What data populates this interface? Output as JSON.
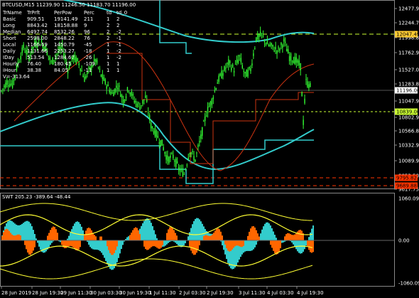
{
  "header": {
    "symbol_line": "BTCUSD,M15  11239.90 11246.50 11183.70 11196.00"
  },
  "stats_table": {
    "columns": [
      "TrName",
      "TrPrft",
      "PerPow",
      "Perc",
      "td",
      "td_0"
    ],
    "rows": [
      [
        "Basic",
        "909.51",
        "19141.49",
        "211",
        "1",
        "2"
      ],
      [
        "Long",
        "8843.42",
        "18158.88",
        "9",
        "2",
        "2"
      ],
      [
        "Median",
        "6497.74",
        "8532.26",
        "96",
        "2",
        "-2"
      ],
      [
        "Short",
        "2598.00",
        "2848.22",
        "76",
        "2",
        "-1"
      ],
      [
        "Local",
        "1166.69",
        "1450.79",
        "-45",
        "1",
        "-1"
      ],
      [
        "Daily",
        "1131.66",
        "2253.27",
        "-18",
        "1",
        "-2"
      ],
      [
        "IDay",
        "513.54",
        "1284.67",
        "-26",
        "1",
        "-2"
      ],
      [
        "Hourly",
        "76.40",
        "180.45",
        "-109",
        "1",
        "1"
      ],
      [
        "iHour",
        "38.38",
        "84.05",
        "-11",
        "1",
        "1"
      ]
    ],
    "footer": "V=-313.64"
  },
  "price_axis": {
    "ticks": [
      "12477.95",
      "12244.70",
      "11998.85",
      "11762.96",
      "11527.00",
      "11283.80",
      "11047.95",
      "10802.99",
      "10566.80",
      "10332.95",
      "10089.90",
      "9853.50",
      "9617.75"
    ],
    "markers": [
      {
        "text": "12047.49",
        "color": "#ffcc33",
        "text_color": "#000000"
      },
      {
        "text": "11196.00",
        "color": "#ffffff",
        "text_color": "#000000"
      },
      {
        "text": "10839.00",
        "color": "#ccff33",
        "text_color": "#000000"
      },
      {
        "text": "9795.82",
        "color": "#ff3300",
        "text_color": "#000000"
      },
      {
        "text": "9689.88",
        "color": "#ff3300",
        "text_color": "#000000"
      }
    ]
  },
  "oscillator": {
    "label": "SWT 205.23 -389.64 -48.44",
    "ticks": [
      "1060.09",
      "0.00",
      "-1060.09"
    ]
  },
  "time_axis": {
    "ticks": [
      "28 Jun 2019",
      "28 Jun 19:30",
      "29 Jun 11:30",
      "30 Jun 03:30",
      "30 Jun 19:30",
      "1 Jul 11:30",
      "2 Jul 03:30",
      "2 Jul 19:30",
      "3 Jul 11:30",
      "4 Jul 03:30",
      "4 Jul 19:30"
    ]
  },
  "chart_data": {
    "type": "candlestick",
    "symbol": "BTCUSD",
    "timeframe": "M15",
    "open": 11239.9,
    "high": 11246.5,
    "low": 11183.7,
    "close": 11196.0,
    "ylim": [
      9617.75,
      12477.95
    ],
    "price_trace": [
      [
        0,
        11150
      ],
      [
        4,
        11300
      ],
      [
        8,
        11250
      ],
      [
        12,
        11600
      ],
      [
        16,
        11850
      ],
      [
        20,
        11700
      ],
      [
        24,
        11900
      ],
      [
        28,
        11950
      ],
      [
        32,
        11850
      ],
      [
        36,
        11600
      ],
      [
        40,
        11750
      ],
      [
        44,
        11850
      ],
      [
        48,
        11500
      ],
      [
        52,
        11700
      ],
      [
        56,
        11600
      ],
      [
        60,
        11350
      ],
      [
        64,
        11500
      ],
      [
        68,
        11650
      ],
      [
        72,
        11400
      ],
      [
        76,
        11250
      ],
      [
        80,
        11100
      ],
      [
        84,
        11250
      ],
      [
        88,
        11000
      ],
      [
        92,
        11200
      ],
      [
        96,
        11000
      ],
      [
        100,
        10900
      ],
      [
        104,
        11050
      ],
      [
        108,
        10600
      ],
      [
        112,
        10450
      ],
      [
        116,
        10300
      ],
      [
        120,
        10050
      ],
      [
        124,
        10100
      ],
      [
        128,
        9900
      ],
      [
        132,
        9820
      ],
      [
        136,
        10200
      ],
      [
        140,
        10050
      ],
      [
        144,
        10400
      ],
      [
        148,
        10800
      ],
      [
        152,
        11000
      ],
      [
        156,
        11300
      ],
      [
        160,
        11450
      ],
      [
        164,
        11600
      ],
      [
        168,
        11500
      ],
      [
        172,
        11700
      ],
      [
        176,
        11400
      ],
      [
        180,
        11500
      ],
      [
        184,
        12000
      ],
      [
        188,
        12050
      ],
      [
        192,
        11900
      ],
      [
        196,
        11850
      ],
      [
        200,
        11800
      ],
      [
        204,
        11950
      ],
      [
        208,
        11700
      ],
      [
        212,
        11650
      ],
      [
        216,
        11550
      ],
      [
        218,
        10650
      ],
      [
        220,
        11300
      ],
      [
        224,
        11196
      ]
    ]
  },
  "colors": {
    "background": "#000000",
    "candles": "#33ff33",
    "ma_long": "#33cccc",
    "ma_red": "#cc3311",
    "level_yellow": "#ccff33",
    "osc_orange": "#ff6600",
    "osc_cyan": "#33cccc",
    "osc_yellow": "#ffff33"
  }
}
